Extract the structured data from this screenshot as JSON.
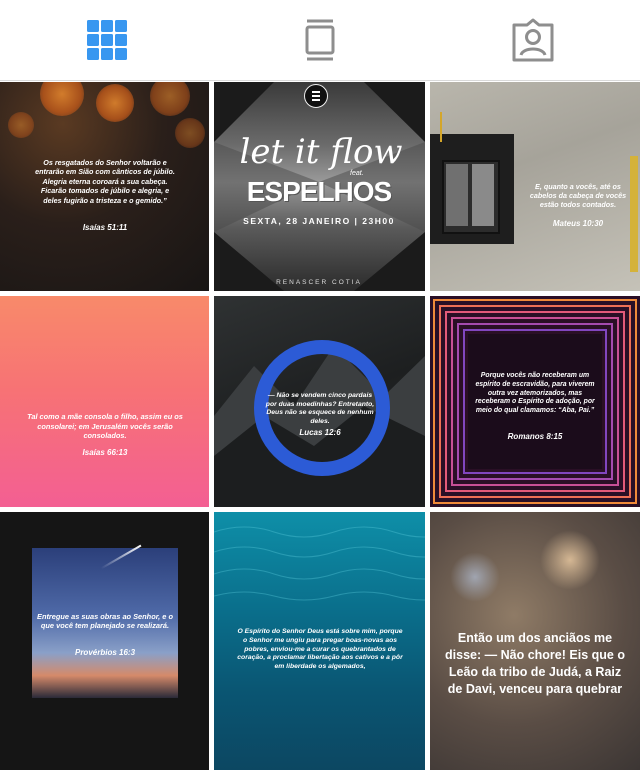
{
  "tabs": [
    {
      "name": "grid-icon",
      "active": true
    },
    {
      "name": "feed-icon",
      "active": false
    },
    {
      "name": "tagged-icon",
      "active": false
    }
  ],
  "colors": {
    "active_tab": "#3897f0",
    "inactive_tab": "#8e8e8e"
  },
  "posts": [
    {
      "caption": "Os resgatados do Senhor voltarão e entrarão em Sião com cânticos de júbilo. Alegria eterna coroará a sua cabeça. Ficarão tomados de júbilo e alegria, e deles fugirão a tristeza e o gemido.”",
      "reference": "Isaías 51:11"
    },
    {
      "title_script": "let it flow",
      "title_small": "feat.",
      "title_main": "ESPELHOS",
      "date": "SEXTA, 28 JANEIRO | 23H00",
      "footer": "RENASCER COTIA"
    },
    {
      "caption": "E, quanto a vocês, até os cabelos da cabeça de vocês estão todos contados.",
      "reference": "Mateus 10:30"
    },
    {
      "caption": "Tal como a mãe consola o filho, assim eu os consolarei; em Jerusalém vocês serão consolados.",
      "reference": "Isaías 66:13"
    },
    {
      "caption": "— Não se vendem cinco pardais por duas moedinhas? Entretanto, Deus não se esquece de nenhum deles.",
      "reference": "Lucas 12:6"
    },
    {
      "caption": "Porque vocês não receberam um espírito de escravidão, para viverem outra vez atemorizados, mas receberam o Espírito de adoção, por meio do qual clamamos: “Aba, Pai.”",
      "reference": "Romanos 8:15"
    },
    {
      "caption": "Entregue as suas obras ao Senhor, e o que você tem planejado se realizará.",
      "reference": "Provérbios 16:3"
    },
    {
      "caption": "O Espírito do Senhor Deus está sobre mim, porque o Senhor me ungiu para pregar boas-novas aos pobres, enviou-me a curar os quebrantados de coração, a proclamar libertação aos cativos e a pôr em liberdade os algemados,",
      "reference": ""
    },
    {
      "caption": "Então um dos anciãos me disse: — Não chore! Eis que o Leão da tribo de Judá, a Raiz de Davi, venceu para quebrar",
      "reference": ""
    }
  ]
}
